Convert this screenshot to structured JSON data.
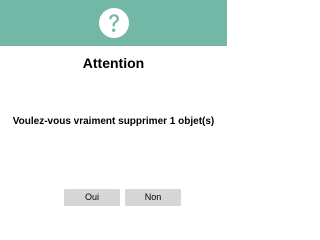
{
  "dialog": {
    "icon": "question-mark-icon",
    "header_color": "#73b8a7",
    "title": "Attention",
    "message": "Voulez-vous vraiment supprimer 1 objet(s)",
    "buttons": {
      "yes_label": "Oui",
      "no_label": "Non"
    }
  }
}
